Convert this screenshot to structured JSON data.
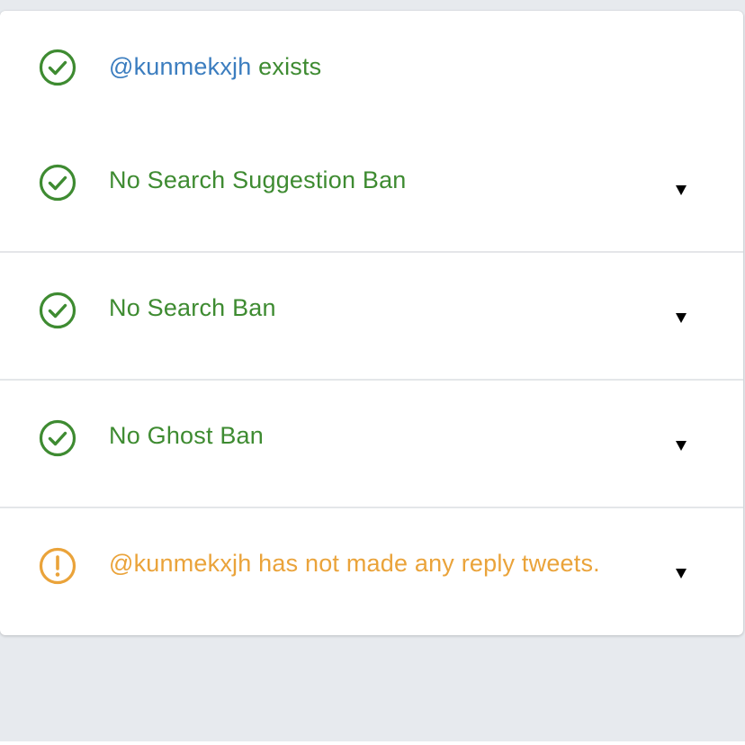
{
  "colors": {
    "success": "#3e8b31",
    "warning": "#eaa33a",
    "handle": "#3b7dbf",
    "toggle": "#000000",
    "page_bg": "#e7eaee"
  },
  "checks": [
    {
      "icon": "check-circle-icon",
      "status": "ok",
      "handle": "@kunmekxjh",
      "text": " exists",
      "expandable": false
    },
    {
      "icon": "check-circle-icon",
      "status": "ok",
      "text": "No Search Suggestion Ban",
      "toggle_icon": "triangle-down-icon",
      "expandable": true
    },
    {
      "icon": "check-circle-icon",
      "status": "ok",
      "text": "No Search Ban",
      "toggle_icon": "triangle-down-icon",
      "expandable": true
    },
    {
      "icon": "check-circle-icon",
      "status": "ok",
      "text": "No Ghost Ban",
      "toggle_icon": "triangle-down-icon",
      "expandable": true
    },
    {
      "icon": "exclamation-circle-icon",
      "status": "warning",
      "text": "@kunmekxjh has not made any reply tweets.",
      "toggle_icon": "triangle-down-icon",
      "expandable": true
    }
  ]
}
